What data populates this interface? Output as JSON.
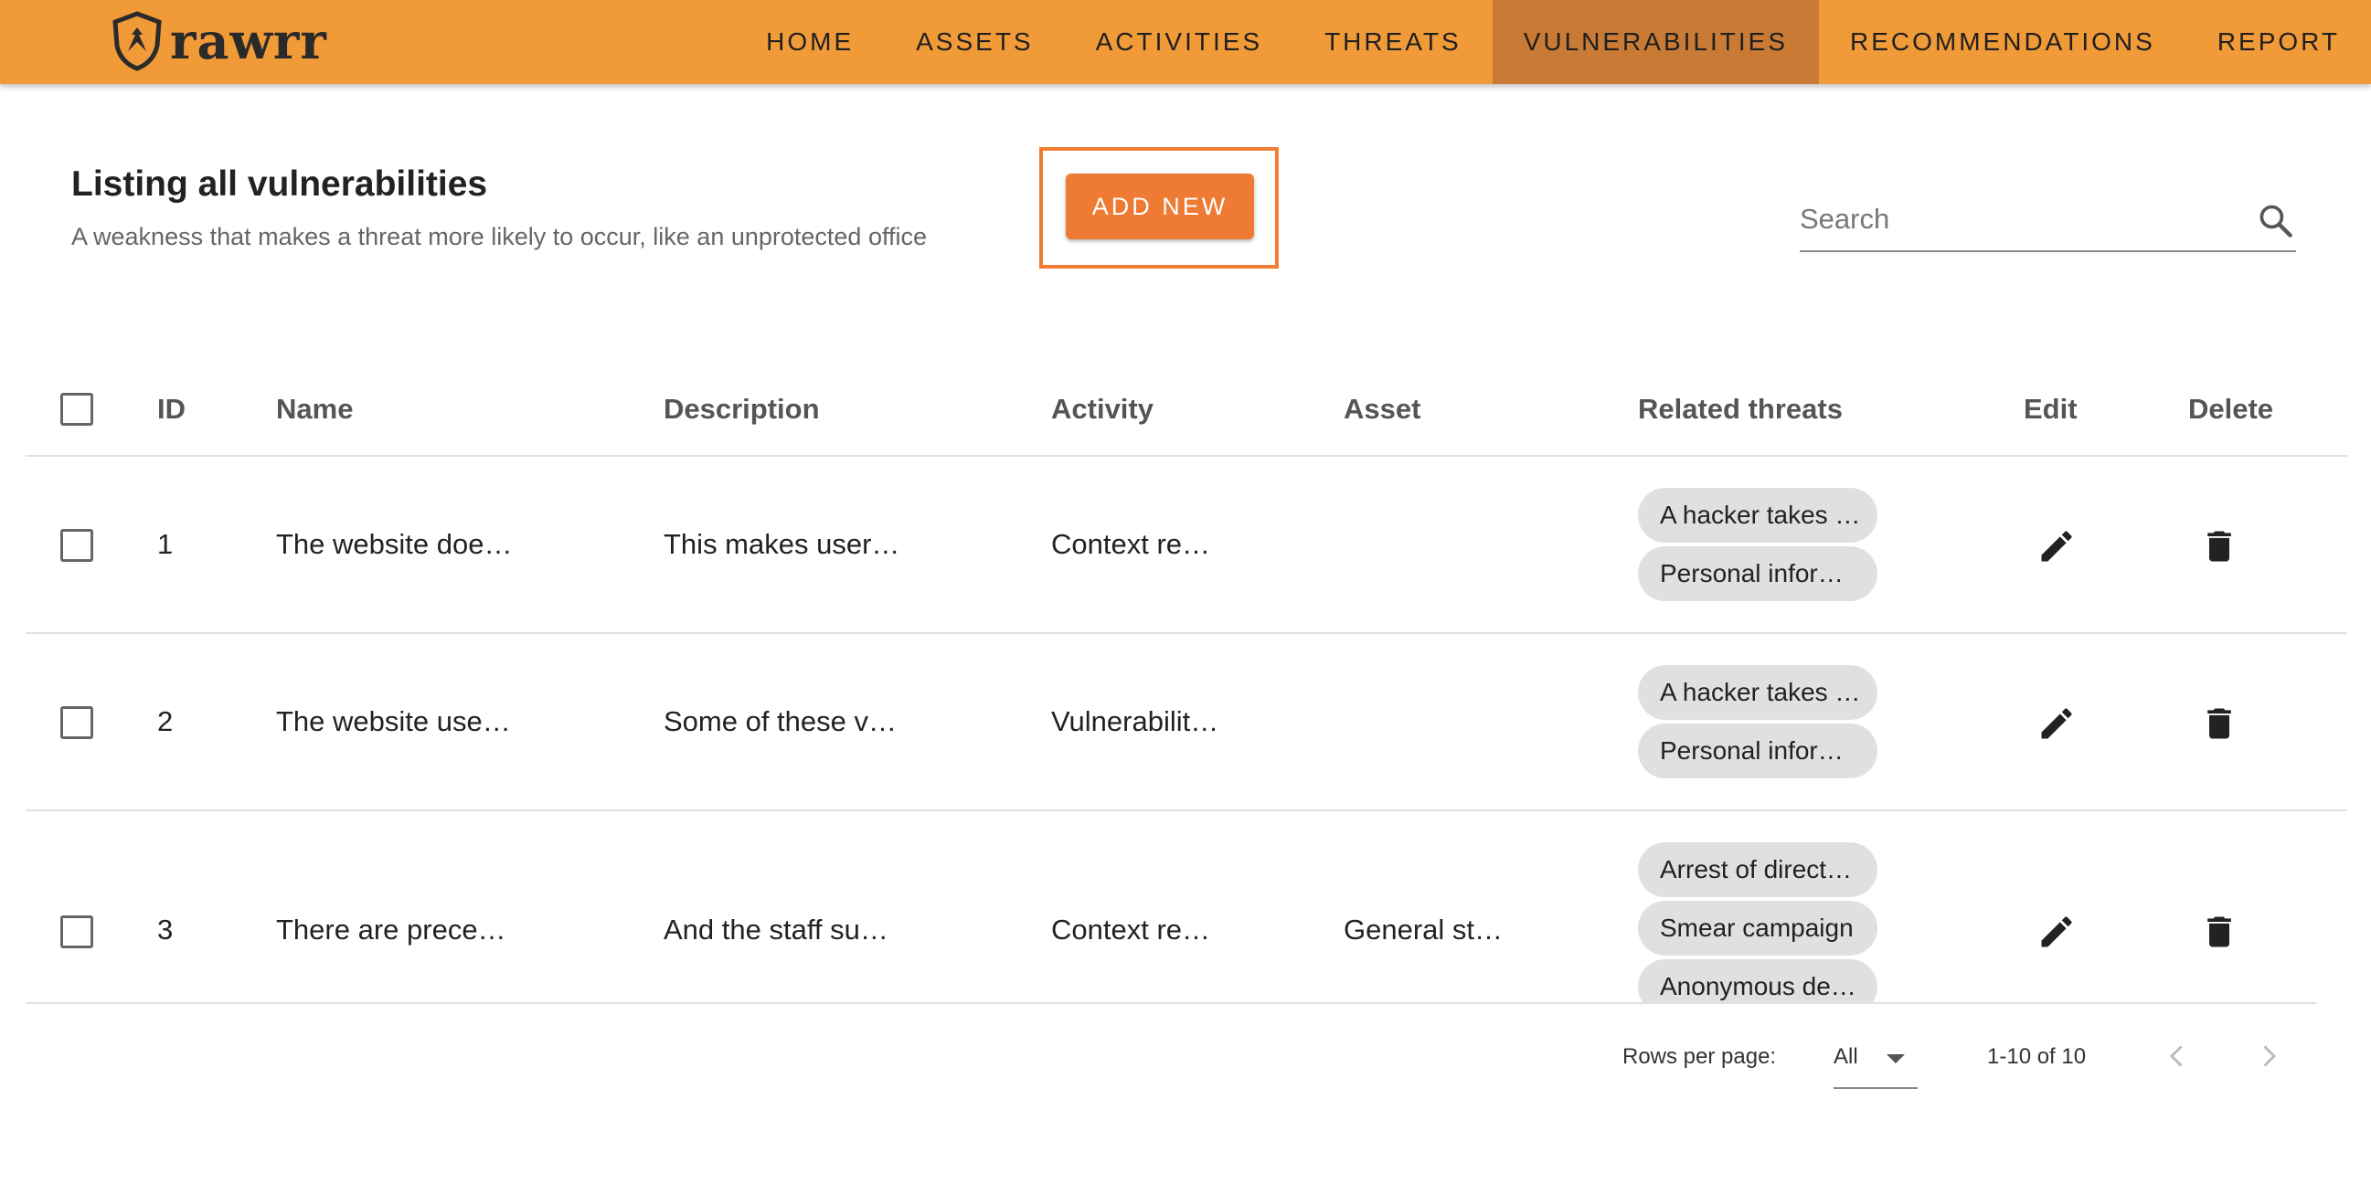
{
  "header": {
    "logo_text": "rawrr",
    "nav": [
      {
        "label": "HOME",
        "active": false
      },
      {
        "label": "ASSETS",
        "active": false
      },
      {
        "label": "ACTIVITIES",
        "active": false
      },
      {
        "label": "THREATS",
        "active": false
      },
      {
        "label": "VULNERABILITIES",
        "active": true
      },
      {
        "label": "RECOMMENDATIONS",
        "active": false
      },
      {
        "label": "REPORT",
        "active": false
      }
    ]
  },
  "page": {
    "title": "Listing all vulnerabilities",
    "subtitle": "A weakness that makes a threat more likely to occur, like an unprotected office",
    "add_button": "ADD NEW",
    "search_placeholder": "Search"
  },
  "table": {
    "columns": [
      "ID",
      "Name",
      "Description",
      "Activity",
      "Asset",
      "Related threats",
      "Edit",
      "Delete"
    ],
    "rows": [
      {
        "id": "1",
        "name": "The website doe…",
        "description": "This makes user…",
        "activity": "Context re…",
        "asset": "",
        "threats": [
          "A hacker takes …",
          "Personal infor…"
        ]
      },
      {
        "id": "2",
        "name": "The website use…",
        "description": "Some of these v…",
        "activity": "Vulnerabilit…",
        "asset": "",
        "threats": [
          "A hacker takes …",
          "Personal infor…"
        ]
      },
      {
        "id": "3",
        "name": "There are prece…",
        "description": "And the staff su…",
        "activity": "Context re…",
        "asset": "General st…",
        "threats": [
          "Arrest of direct…",
          "Smear campaign",
          "Anonymous de…"
        ]
      }
    ]
  },
  "footer": {
    "rows_per_page_label": "Rows per page:",
    "rows_per_page_value": "All",
    "range": "1-10 of 10"
  },
  "colors": {
    "header_bg": "#f19a38",
    "nav_active_bg": "#c97b35",
    "accent": "#ee7a33",
    "chip_bg": "#e0e0e0"
  }
}
